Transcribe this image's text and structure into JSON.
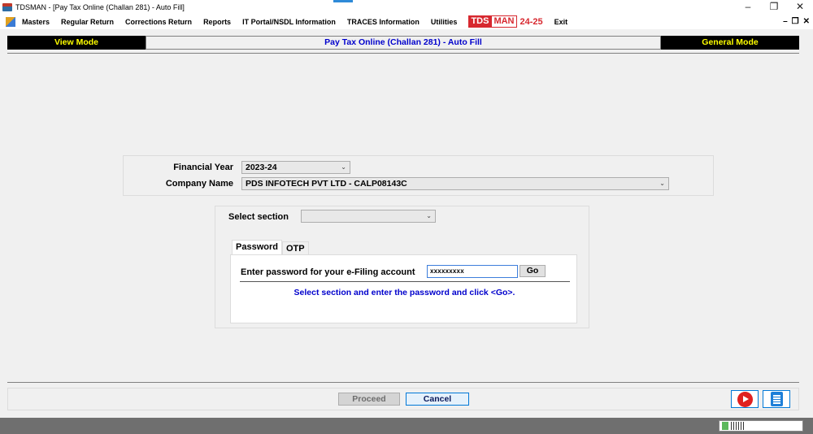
{
  "window": {
    "title": "TDSMAN - [Pay Tax Online (Challan 281) - Auto Fill]",
    "controls": {
      "minimize": "–",
      "restore": "❐",
      "close": "✕"
    }
  },
  "menu": {
    "items": [
      "Masters",
      "Regular Return",
      "Corrections Return",
      "Reports",
      "IT Portal/NSDL Information",
      "TRACES Information",
      "Utilities"
    ],
    "brand": {
      "tds": "TDS",
      "man": "MAN",
      "version": "24-25"
    },
    "exit": "Exit",
    "mdi_controls": {
      "minimize": "–",
      "restore": "❐",
      "close": "✕"
    }
  },
  "mode_bar": {
    "left": "View Mode",
    "center": "Pay Tax Online (Challan 281) - Auto Fill",
    "right": "General Mode"
  },
  "form": {
    "financial_year_label": "Financial Year",
    "financial_year_value": "2023-24",
    "company_name_label": "Company Name",
    "company_name_value": "PDS INFOTECH PVT LTD - CALP08143C",
    "select_section_label": "Select section",
    "select_section_value": ""
  },
  "auth": {
    "tabs": [
      "Password",
      "OTP"
    ],
    "active_tab": "Password",
    "password_label": "Enter password for your e-Filing account",
    "password_value": "xxxxxxxxx",
    "go_label": "Go",
    "hint": "Select section and enter the password and click <Go>."
  },
  "footer": {
    "proceed_label": "Proceed",
    "cancel_label": "Cancel",
    "icons": [
      "youtube-play-icon",
      "document-icon"
    ]
  },
  "colors": {
    "mode_bar_bg": "#000000",
    "mode_bar_text": "#ffff00",
    "title_blue": "#0000cc",
    "brand_red": "#d7282f",
    "focus_blue": "#0078d7"
  }
}
